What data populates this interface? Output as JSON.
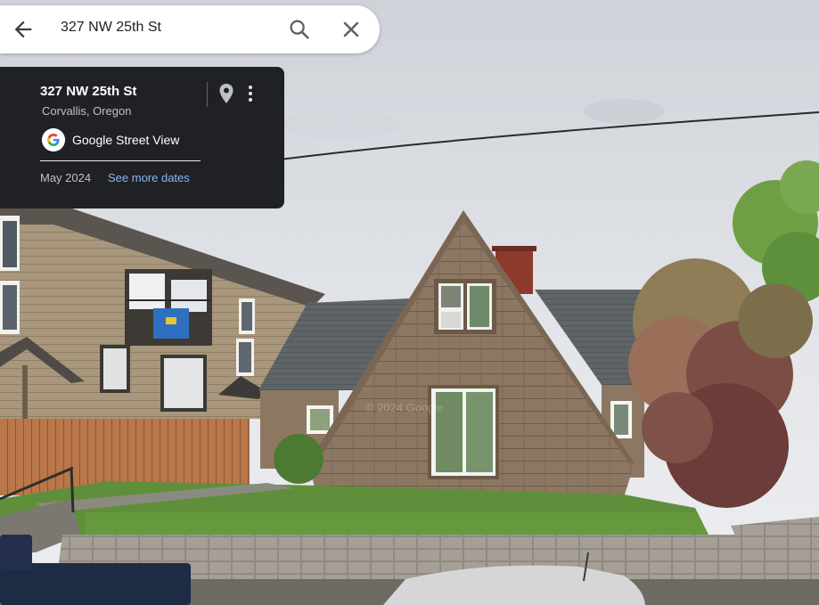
{
  "search": {
    "query": "327 NW 25th St"
  },
  "place_card": {
    "title": "327 NW 25th St",
    "subtitle": "Corvallis, Oregon",
    "provider_label": "Google Street View",
    "date": "May 2024",
    "see_more_dates": "See more dates"
  },
  "scene": {
    "watermark": "© 2024 Google"
  },
  "colors": {
    "card_bg": "#202124",
    "link": "#8ab4f8",
    "search_bg": "#ffffff",
    "sky": "#dfe2e6",
    "lawn": "#5f8f3a",
    "siding": "#8a7660"
  },
  "icons": [
    "back-arrow-icon",
    "search-icon",
    "close-icon",
    "location-pin-icon",
    "more-vert-icon",
    "google-logo-icon"
  ]
}
